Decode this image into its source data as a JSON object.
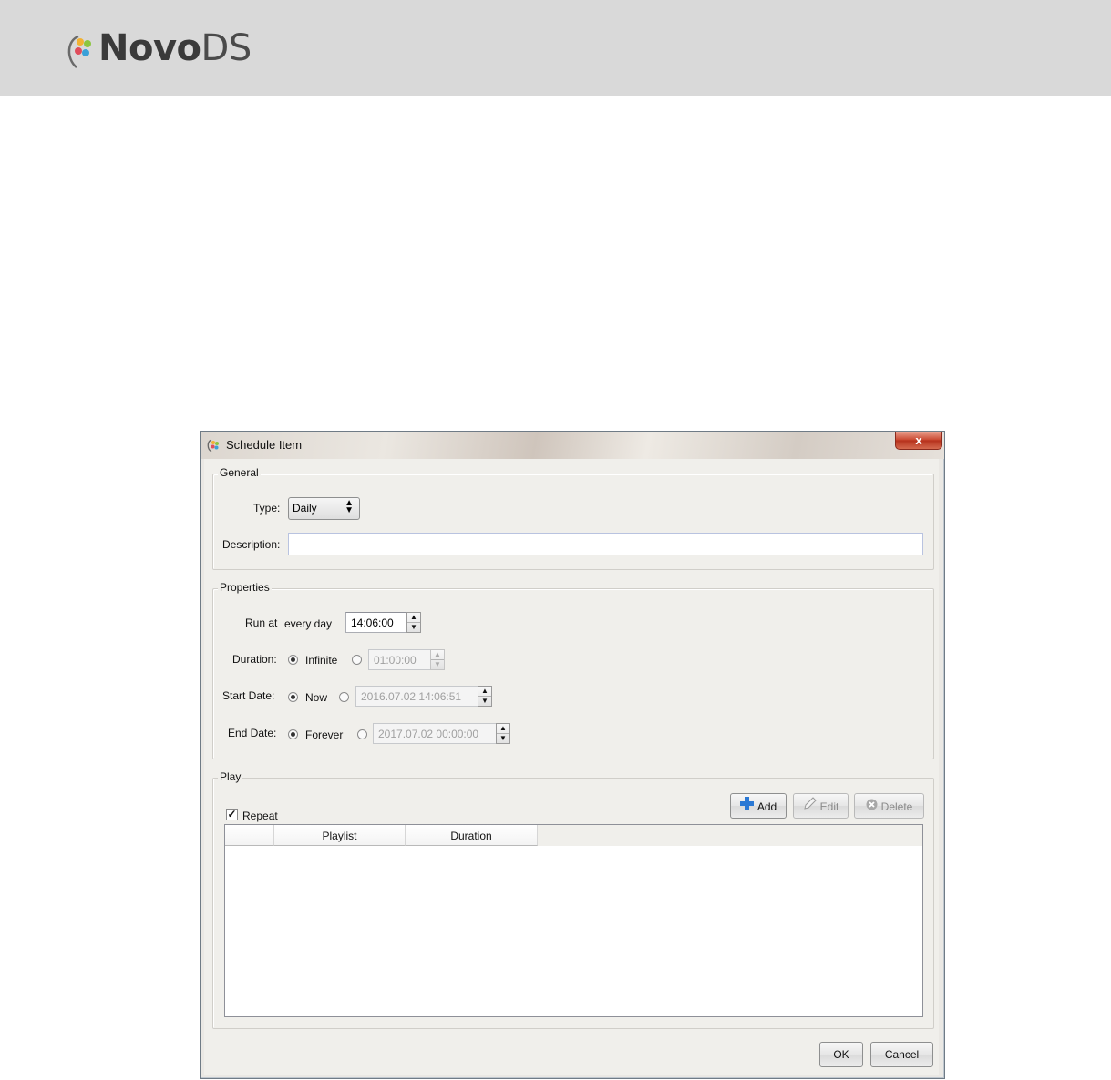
{
  "brand": {
    "name_bold": "Novo",
    "name_light": "DS"
  },
  "window": {
    "title": "Schedule Item",
    "close_label": "x"
  },
  "general": {
    "title": "General",
    "type_label": "Type:",
    "type_value": "Daily",
    "description_label": "Description:",
    "description_value": ""
  },
  "properties": {
    "title": "Properties",
    "run_at_label": "Run at",
    "run_at_every": "every day",
    "run_at_time": "14:06:00",
    "duration_label": "Duration:",
    "duration_option": "Infinite",
    "duration_value": "01:00:00",
    "start_label": "Start Date:",
    "start_option": "Now",
    "start_value": "2016.07.02 14:06:51",
    "end_label": "End Date:",
    "end_option": "Forever",
    "end_value": "2017.07.02 00:00:00"
  },
  "play": {
    "title": "Play",
    "repeat_label": "Repeat",
    "repeat_checked": true,
    "add_label": "Add",
    "edit_label": "Edit",
    "delete_label": "Delete",
    "columns": [
      "",
      "Playlist",
      "Duration"
    ],
    "rows": []
  },
  "footer": {
    "ok_label": "OK",
    "cancel_label": "Cancel"
  }
}
